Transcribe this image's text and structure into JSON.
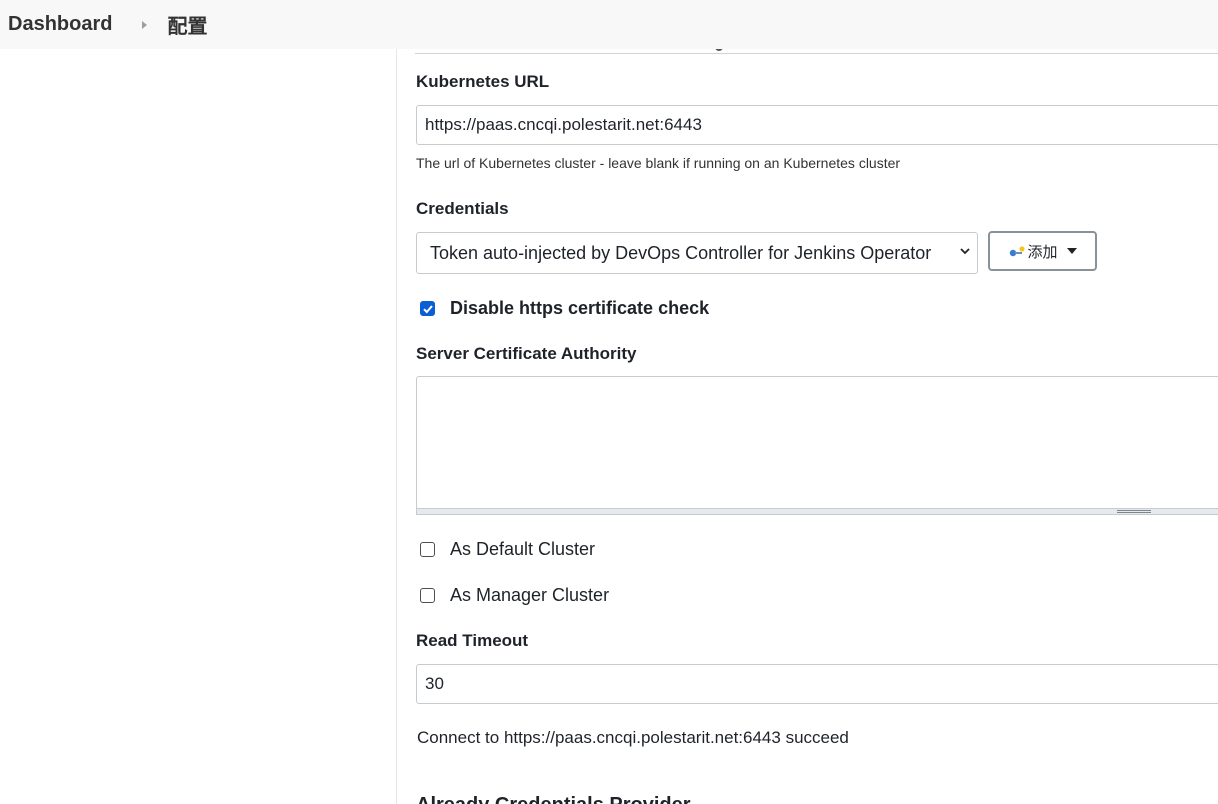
{
  "breadcrumb": {
    "items": [
      "Dashboard",
      "配置"
    ]
  },
  "form": {
    "kubernetes_url": {
      "label": "Kubernetes URL",
      "value": "https://paas.cncqi.polestarit.net:6443",
      "help": "The url of Kubernetes cluster - leave blank if running on an Kubernetes cluster"
    },
    "credentials": {
      "label": "Credentials",
      "selected": "Token auto-injected by DevOps Controller for Jenkins Operator",
      "add_button_label": "添加"
    },
    "disable_https_check": {
      "label": "Disable https certificate check",
      "checked": true
    },
    "server_ca": {
      "label": "Server Certificate Authority",
      "value": ""
    },
    "default_cluster": {
      "label": "As Default Cluster",
      "checked": false
    },
    "manager_cluster": {
      "label": "As Manager Cluster",
      "checked": false
    },
    "read_timeout": {
      "label": "Read Timeout",
      "value": "30"
    },
    "connection_status": "Connect to https://paas.cncqi.polestarit.net:6443 succeed",
    "next_section_partial": "Already Credentials Provider"
  },
  "icons": {
    "add_button_icon": "key-icon",
    "select_icon": "chevron-down-icon",
    "add_caret": "caret-down-icon"
  },
  "colors": {
    "checkbox_checked": "#0b5fd6",
    "breadcrumb_bg": "#f8f8f8",
    "input_border": "#c6cbd2"
  }
}
